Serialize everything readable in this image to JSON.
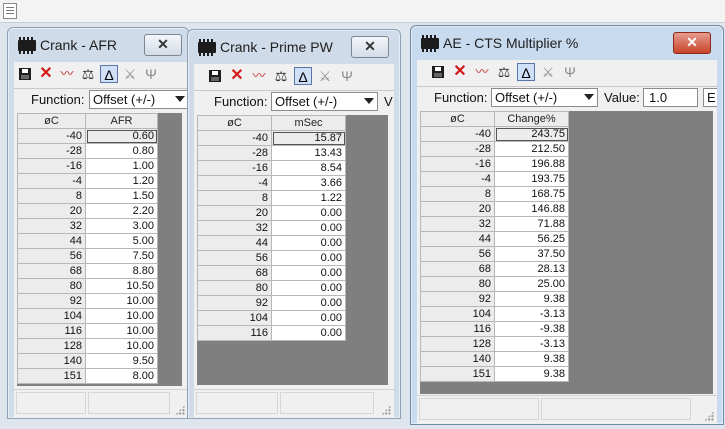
{
  "windows": [
    {
      "id": "crank-afr",
      "title": "Crank - AFR",
      "function_label": "Function:",
      "function_value": "Offset (+/-)",
      "headers": [
        "øC",
        "AFR"
      ],
      "rows": [
        [
          "-40",
          "0.60"
        ],
        [
          "-28",
          "0.80"
        ],
        [
          "-16",
          "1.00"
        ],
        [
          "-4",
          "1.20"
        ],
        [
          "8",
          "1.50"
        ],
        [
          "20",
          "2.20"
        ],
        [
          "32",
          "3.00"
        ],
        [
          "44",
          "5.00"
        ],
        [
          "56",
          "7.50"
        ],
        [
          "68",
          "8.80"
        ],
        [
          "80",
          "10.50"
        ],
        [
          "92",
          "10.00"
        ],
        [
          "104",
          "10.00"
        ],
        [
          "116",
          "10.00"
        ],
        [
          "128",
          "10.00"
        ],
        [
          "140",
          "9.50"
        ],
        [
          "151",
          "8.00"
        ]
      ]
    },
    {
      "id": "crank-prime-pw",
      "title": "Crank - Prime PW",
      "function_label": "Function:",
      "function_value": "Offset (+/-)",
      "value_label_partial": "V",
      "headers": [
        "øC",
        "mSec"
      ],
      "rows": [
        [
          "-40",
          "15.87"
        ],
        [
          "-28",
          "13.43"
        ],
        [
          "-16",
          "8.54"
        ],
        [
          "-4",
          "3.66"
        ],
        [
          "8",
          "1.22"
        ],
        [
          "20",
          "0.00"
        ],
        [
          "32",
          "0.00"
        ],
        [
          "44",
          "0.00"
        ],
        [
          "56",
          "0.00"
        ],
        [
          "68",
          "0.00"
        ],
        [
          "80",
          "0.00"
        ],
        [
          "92",
          "0.00"
        ],
        [
          "104",
          "0.00"
        ],
        [
          "116",
          "0.00"
        ]
      ]
    },
    {
      "id": "ae-cts-multiplier",
      "title": "AE - CTS Multiplier %",
      "function_label": "Function:",
      "function_value": "Offset (+/-)",
      "value_label": "Value:",
      "value_value": "1.0",
      "extra_button_partial": "E",
      "headers": [
        "øC",
        "Change%"
      ],
      "rows": [
        [
          "-40",
          "243.75"
        ],
        [
          "-28",
          "212.50"
        ],
        [
          "-16",
          "196.88"
        ],
        [
          "-4",
          "193.75"
        ],
        [
          "8",
          "168.75"
        ],
        [
          "20",
          "146.88"
        ],
        [
          "32",
          "71.88"
        ],
        [
          "44",
          "56.25"
        ],
        [
          "56",
          "37.50"
        ],
        [
          "68",
          "28.13"
        ],
        [
          "80",
          "25.00"
        ],
        [
          "92",
          "9.38"
        ],
        [
          "104",
          "-3.13"
        ],
        [
          "116",
          "-9.38"
        ],
        [
          "128",
          "-3.13"
        ],
        [
          "140",
          "9.38"
        ],
        [
          "151",
          "9.38"
        ]
      ]
    }
  ],
  "toolbar_icons": [
    "save-icon",
    "delete-x-icon",
    "graph-icon",
    "scale-icon",
    "warp-icon-selected",
    "warp-icon",
    "tuning-fork-icon"
  ],
  "close_glyph": "✕"
}
